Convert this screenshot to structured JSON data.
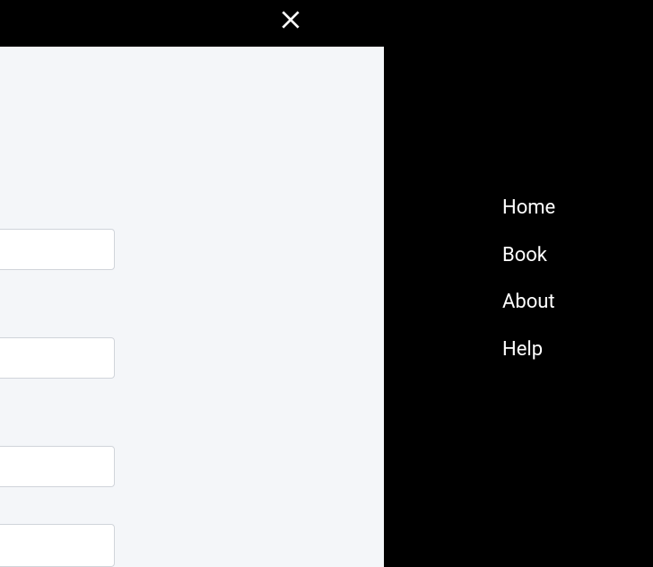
{
  "nav": {
    "items": [
      {
        "label": "Home"
      },
      {
        "label": "Book"
      },
      {
        "label": "About"
      },
      {
        "label": "Help"
      }
    ]
  }
}
